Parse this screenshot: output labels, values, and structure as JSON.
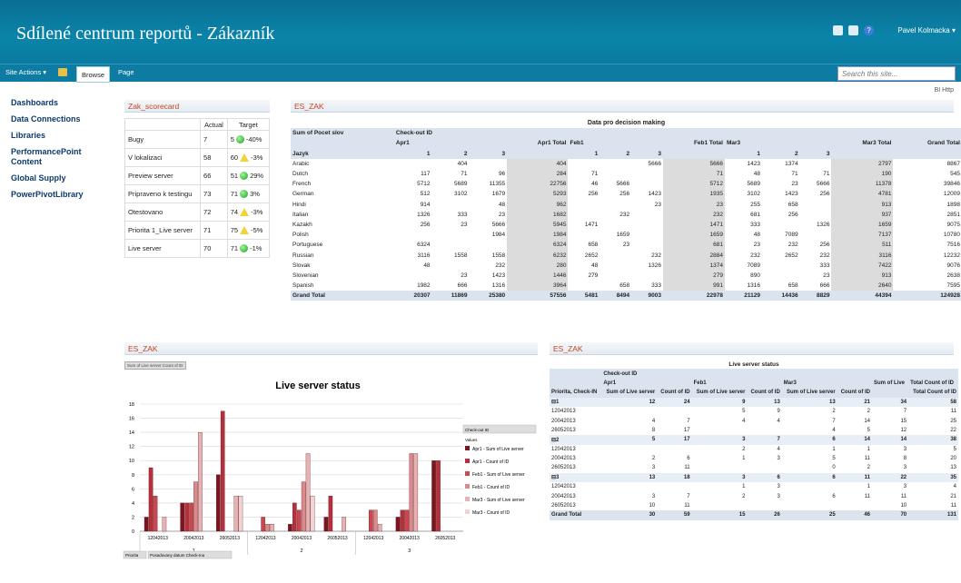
{
  "header": {
    "title": "Sdílené centrum reportů - Zákazník",
    "user": "Pavel Kolmacka ▾",
    "help": "?"
  },
  "ribbon": {
    "site_actions": "Site Actions ▾",
    "browse": "Browse",
    "page": "Page",
    "search_placeholder": "Search this site...",
    "bi_http": "BI Http"
  },
  "nav": [
    "Dashboards",
    "Data Connections",
    "Libraries",
    "PerformancePoint Content",
    "Global Supply",
    "PowerPivotLibrary"
  ],
  "scorecard": {
    "title": "Zak_scorecard",
    "col_actual": "Actual",
    "col_target": "Target",
    "rows": [
      {
        "name": "Bugy",
        "actual": "7",
        "target": "5",
        "status": "green",
        "pct": "-40%"
      },
      {
        "name": "V lokalizaci",
        "actual": "58",
        "target": "60",
        "status": "yellow",
        "pct": "-3%"
      },
      {
        "name": "Preview server",
        "actual": "66",
        "target": "51",
        "status": "green",
        "pct": "29%"
      },
      {
        "name": "Pripraveno k testingu",
        "actual": "73",
        "target": "71",
        "status": "green",
        "pct": "3%"
      },
      {
        "name": "Otestovano",
        "actual": "72",
        "target": "74",
        "status": "yellow",
        "pct": "-3%"
      },
      {
        "name": "Priorita 1_Live server",
        "actual": "71",
        "target": "75",
        "status": "yellow",
        "pct": "-5%"
      },
      {
        "name": "Live server",
        "actual": "70",
        "target": "71",
        "status": "green",
        "pct": "-1%"
      }
    ]
  },
  "pivot": {
    "wp_title": "ES_ZAK",
    "caption": "Data pro decision making",
    "measure": "Sum of Pocet slov",
    "col_field": "Check-out ID",
    "row_field": "Jazyk",
    "groups": [
      "Apr1",
      "Apr1 Total",
      "Feb1",
      "Feb1 Total",
      "Mar3",
      "Mar3 Total",
      "Grand Total"
    ],
    "subcols": [
      "1",
      "2",
      "3"
    ],
    "rows": [
      [
        "Arabic",
        "",
        "404",
        "",
        "404",
        "",
        "",
        "5666",
        "5666",
        "1423",
        "1374",
        "",
        "2797",
        "8867"
      ],
      [
        "Dutch",
        "117",
        "71",
        "96",
        "284",
        "71",
        "",
        "",
        "71",
        "48",
        "71",
        "71",
        "190",
        "545"
      ],
      [
        "French",
        "5712",
        "5689",
        "11355",
        "22756",
        "46",
        "5666",
        "",
        "5712",
        "5689",
        "23",
        "5666",
        "11378",
        "39846"
      ],
      [
        "German",
        "512",
        "3102",
        "1679",
        "5293",
        "256",
        "256",
        "1423",
        "1935",
        "3102",
        "1423",
        "256",
        "4781",
        "12009"
      ],
      [
        "Hindi",
        "914",
        "",
        "48",
        "962",
        "",
        "",
        "23",
        "23",
        "255",
        "658",
        "",
        "913",
        "1898"
      ],
      [
        "Italian",
        "1326",
        "333",
        "23",
        "1682",
        "",
        "232",
        "",
        "232",
        "681",
        "256",
        "",
        "937",
        "2851"
      ],
      [
        "Kazakh",
        "256",
        "23",
        "5666",
        "5945",
        "1471",
        "",
        "",
        "1471",
        "333",
        "",
        "1326",
        "1659",
        "9075"
      ],
      [
        "Polish",
        "",
        "",
        "1984",
        "1984",
        "",
        "1659",
        "",
        "1659",
        "48",
        "7089",
        "",
        "7137",
        "10780"
      ],
      [
        "Portuguese",
        "6324",
        "",
        "",
        "6324",
        "658",
        "23",
        "",
        "681",
        "23",
        "232",
        "256",
        "511",
        "7516"
      ],
      [
        "Russian",
        "3116",
        "1558",
        "1558",
        "6232",
        "2652",
        "",
        "232",
        "2884",
        "232",
        "2652",
        "232",
        "3116",
        "12232"
      ],
      [
        "Slovak",
        "48",
        "",
        "232",
        "280",
        "48",
        "",
        "1326",
        "1374",
        "7089",
        "",
        "333",
        "7422",
        "9076"
      ],
      [
        "Slovenian",
        "",
        "23",
        "1423",
        "1446",
        "279",
        "",
        "",
        "279",
        "890",
        "",
        "23",
        "913",
        "2638"
      ],
      [
        "Spanish",
        "1982",
        "666",
        "1316",
        "3964",
        "",
        "658",
        "333",
        "991",
        "1316",
        "658",
        "666",
        "2640",
        "7595"
      ]
    ],
    "grand": [
      "Grand Total",
      "20307",
      "11869",
      "25380",
      "57556",
      "5481",
      "8494",
      "9003",
      "22978",
      "21129",
      "14436",
      "8829",
      "44394",
      "124928"
    ]
  },
  "chart_data": {
    "type": "bar",
    "title": "Live server status",
    "wp_title": "ES_ZAK",
    "field_button": "Sum of Live server  Count of ID",
    "ylim": [
      0,
      18
    ],
    "yticks": [
      0,
      2,
      4,
      6,
      8,
      10,
      12,
      14,
      16,
      18
    ],
    "outer": [
      "1",
      "2",
      "3"
    ],
    "categories": [
      "12042013",
      "20042013",
      "26052013",
      "12042013",
      "20042013",
      "26052013",
      "12042013",
      "20042013",
      "26052013"
    ],
    "series": [
      {
        "name": "Apr1 - Sum of Live server",
        "color": "#7a1620",
        "values": [
          2,
          4,
          8,
          0,
          1,
          2,
          0,
          2,
          10
        ]
      },
      {
        "name": "Apr1 - Count of ID",
        "color": "#b3313c",
        "values": [
          9,
          4,
          17,
          0,
          4,
          5,
          0,
          3,
          10
        ]
      },
      {
        "name": "Feb1 - Sum of Live server",
        "color": "#c9474f",
        "values": [
          5,
          4,
          0,
          2,
          3,
          0,
          3,
          3,
          0
        ]
      },
      {
        "name": "Feb1 - Count of ID",
        "color": "#d98a8c",
        "values": [
          0,
          7,
          0,
          1,
          7,
          0,
          3,
          11,
          0
        ]
      },
      {
        "name": "Mar3 - Sum of Live server",
        "color": "#e6b2b4",
        "values": [
          2,
          14,
          5,
          1,
          11,
          2,
          1,
          11,
          0
        ]
      },
      {
        "name": "Mar3 - Count of ID",
        "color": "#f1d3d4",
        "values": [
          0,
          0,
          5,
          0,
          5,
          0,
          0,
          0,
          0
        ]
      }
    ],
    "legend_field": "Check-out ID",
    "legend_values": "Values",
    "filter_buttons": [
      "Priorita",
      "Posadovany datum Check-Inu"
    ]
  },
  "list": {
    "wp_title": "ES_ZAK",
    "caption": "Live server status",
    "col_field": "Check-out ID",
    "groups": [
      "Apr1",
      "Feb1",
      "Mar3",
      "Sum of Live",
      "Total Count of ID"
    ],
    "headers": [
      "Priorita, Check-IN",
      "Sum of Live server",
      "Count of ID",
      "Sum of Live server",
      "Count of ID",
      "Sum of Live server",
      "Count of ID",
      "",
      "Total Count of ID"
    ],
    "rows": [
      {
        "sub": true,
        "c": [
          "⊟1",
          "12",
          "24",
          "9",
          "13",
          "13",
          "21",
          "34",
          "58"
        ]
      },
      {
        "c": [
          "12042013",
          "",
          "",
          "5",
          "9",
          "2",
          "2",
          "7",
          "11"
        ]
      },
      {
        "c": [
          "20042013",
          "4",
          "7",
          "4",
          "4",
          "7",
          "14",
          "15",
          "25"
        ]
      },
      {
        "c": [
          "26052013",
          "8",
          "17",
          "",
          "",
          "4",
          "5",
          "12",
          "22"
        ]
      },
      {
        "sub": true,
        "c": [
          "⊟2",
          "5",
          "17",
          "3",
          "7",
          "6",
          "14",
          "14",
          "38"
        ]
      },
      {
        "c": [
          "12042013",
          "",
          "",
          "2",
          "4",
          "1",
          "1",
          "3",
          "5"
        ]
      },
      {
        "c": [
          "20042013",
          "2",
          "6",
          "1",
          "3",
          "5",
          "11",
          "8",
          "20"
        ]
      },
      {
        "c": [
          "26052013",
          "3",
          "11",
          "",
          "",
          "0",
          "2",
          "3",
          "13"
        ]
      },
      {
        "sub": true,
        "c": [
          "⊟3",
          "13",
          "18",
          "3",
          "6",
          "6",
          "11",
          "22",
          "35"
        ]
      },
      {
        "c": [
          "12042013",
          "",
          "",
          "1",
          "3",
          "",
          "1",
          "3",
          "4"
        ]
      },
      {
        "c": [
          "20042013",
          "3",
          "7",
          "2",
          "3",
          "6",
          "11",
          "11",
          "21"
        ]
      },
      {
        "c": [
          "26052013",
          "10",
          "11",
          "",
          "",
          "",
          "",
          "10",
          "11"
        ]
      }
    ],
    "grand": [
      "Grand Total",
      "30",
      "59",
      "15",
      "26",
      "25",
      "46",
      "70",
      "131"
    ]
  }
}
